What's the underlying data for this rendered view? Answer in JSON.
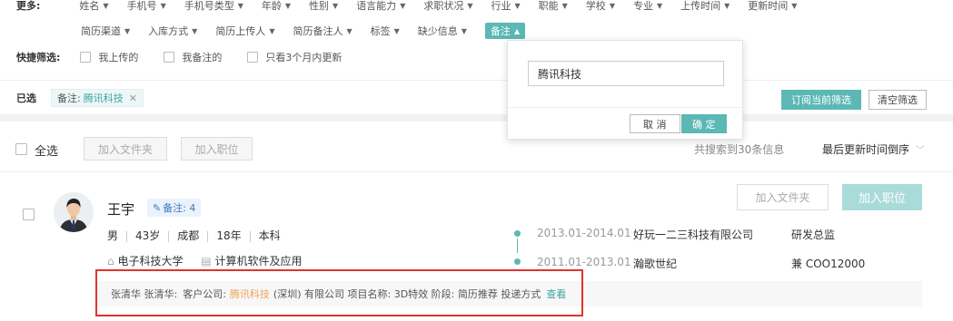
{
  "filters": {
    "more_label": "更多:",
    "row1": [
      "姓名",
      "手机号",
      "手机号类型",
      "年龄",
      "性别",
      "语言能力",
      "求职状况",
      "行业",
      "职能",
      "学校",
      "专业",
      "上传时间",
      "更新时间"
    ],
    "row2": [
      "简历渠道",
      "入库方式",
      "简历上传人",
      "简历备注人",
      "标签",
      "缺少信息"
    ],
    "active": "备注",
    "quick_label": "快捷筛选:",
    "quick": [
      "我上传的",
      "我备注的",
      "只看3个月内更新"
    ],
    "selected_label": "已选",
    "selected_tag_key": "备注:",
    "selected_tag_value": "腾讯科技",
    "subscribe": "订阅当前筛选",
    "clear": "清空筛选"
  },
  "popover": {
    "input_value": "腾讯科技",
    "cancel": "取 消",
    "confirm": "确 定"
  },
  "toolbar": {
    "select_all": "全选",
    "add_folder": "加入文件夹",
    "add_position": "加入职位",
    "result_count": "共搜索到30条信息",
    "sort": "最后更新时间倒序"
  },
  "candidate": {
    "name": "王宇",
    "note_badge": "备注: 4",
    "gender": "男",
    "age": "43岁",
    "city": "成都",
    "experience": "18年",
    "education": "本科",
    "school": "电子科技大学",
    "major": "计算机软件及应用",
    "add_folder": "加入文件夹",
    "add_position": "加入职位",
    "work": [
      {
        "period": "2013.01-2014.01",
        "company": "好玩一二三科技有限公司",
        "title": "研发总监"
      },
      {
        "period": "2011.01-2013.01",
        "company": "瀚歌世纪",
        "title": "兼 COO12000"
      }
    ],
    "remark": {
      "author": "张清华 张清华:",
      "prefix": "客户公司:",
      "highlight": "腾讯科技",
      "rest": "(深圳) 有限公司 项目名称: 3D特效 阶段: 简历推荐 投递方式",
      "link": "查看"
    }
  },
  "colors": {
    "accent": "#5bb8b5",
    "highlight": "#f0a35a",
    "badge": "#3b78c4",
    "red_box": "#e0332f"
  }
}
